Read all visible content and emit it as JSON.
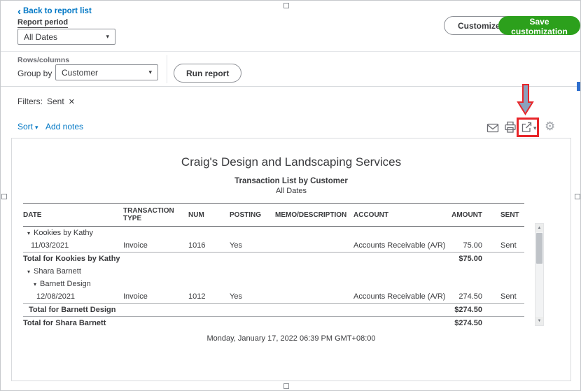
{
  "header": {
    "back_link": "Back to report list"
  },
  "controls": {
    "report_period_label": "Report period",
    "report_period_value": "All Dates",
    "rows_columns_label": "Rows/columns",
    "group_by_label": "Group by",
    "group_by_value": "Customer",
    "run_report": "Run report",
    "customize": "Customize",
    "save_customization": "Save customization"
  },
  "filters": {
    "label": "Filters:",
    "chip": "Sent"
  },
  "toolbar": {
    "sort": "Sort",
    "add_notes": "Add notes"
  },
  "report": {
    "company": "Craig's Design and Landscaping Services",
    "title": "Transaction List by Customer",
    "period": "All Dates",
    "columns": [
      "DATE",
      "TRANSACTION TYPE",
      "NUM",
      "POSTING",
      "MEMO/DESCRIPTION",
      "ACCOUNT",
      "AMOUNT",
      "SENT"
    ],
    "rows": [
      {
        "type": "group",
        "indent": 1,
        "label": "Kookies by Kathy"
      },
      {
        "type": "data",
        "indent": 1,
        "date": "11/03/2021",
        "transaction_type": "Invoice",
        "num": "1016",
        "posting": "Yes",
        "memo": "",
        "account": "Accounts Receivable (A/R)",
        "amount": "75.00",
        "sent": "Sent"
      },
      {
        "type": "total",
        "indent": 0,
        "label": "Total for Kookies by Kathy",
        "amount": "$75.00"
      },
      {
        "type": "group",
        "indent": 1,
        "label": "Shara Barnett"
      },
      {
        "type": "group",
        "indent": 2,
        "label": "Barnett Design"
      },
      {
        "type": "data",
        "indent": 2,
        "date": "12/08/2021",
        "transaction_type": "Invoice",
        "num": "1012",
        "posting": "Yes",
        "memo": "",
        "account": "Accounts Receivable (A/R)",
        "amount": "274.50",
        "sent": "Sent"
      },
      {
        "type": "total",
        "indent": 1,
        "label": "Total for Barnett Design",
        "amount": "$274.50"
      },
      {
        "type": "total",
        "indent": 0,
        "label": "Total for Shara Barnett",
        "amount": "$274.50"
      }
    ],
    "footer": "Monday, January 17, 2022  06:39 PM GMT+08:00"
  },
  "glyphs": {
    "chevron_left": "‹",
    "caret": "▾",
    "close": "✕",
    "gear": "⚙",
    "up": "▲",
    "down": "▼"
  },
  "colors": {
    "accent_green": "#2ca01c",
    "link_blue": "#0077c5",
    "annotation_red": "#e8262a",
    "annotation_arrow_fill": "#8ba1bd",
    "text_dark": "#393a3d"
  }
}
